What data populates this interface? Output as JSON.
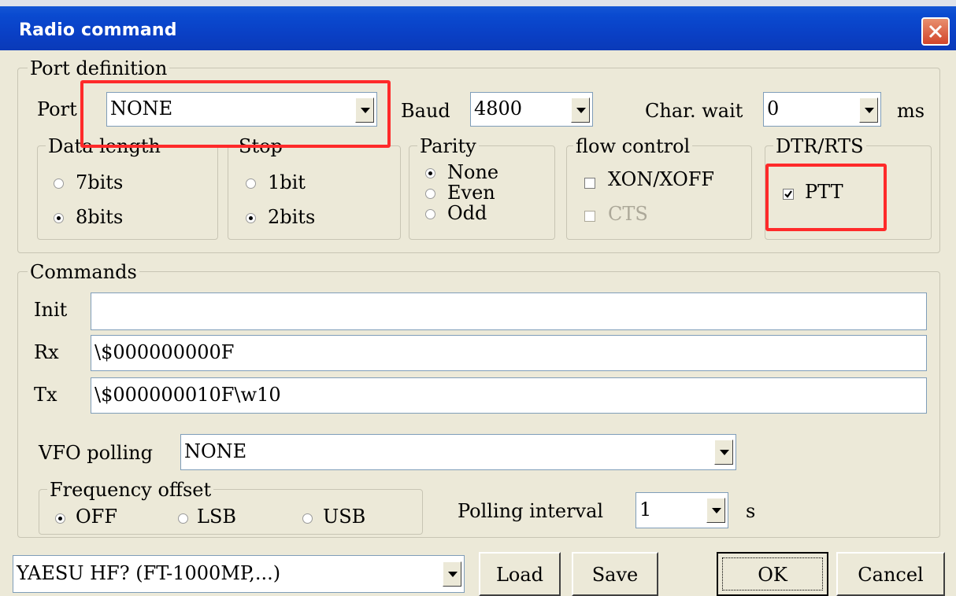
{
  "window": {
    "title": "Radio command"
  },
  "port_def": {
    "legend": "Port definition",
    "port_label": "Port",
    "port_value": "NONE",
    "baud_label": "Baud",
    "baud_value": "4800",
    "charwait_label": "Char. wait",
    "charwait_value": "0",
    "charwait_unit": "ms",
    "data_length": {
      "legend": "Data length",
      "options": [
        "7bits",
        "8bits"
      ],
      "selected": "8bits"
    },
    "stop": {
      "legend": "Stop",
      "options": [
        "1bit",
        "2bits"
      ],
      "selected": "2bits"
    },
    "parity": {
      "legend": "Parity",
      "options": [
        "None",
        "Even",
        "Odd"
      ],
      "selected": "None"
    },
    "flow": {
      "legend": "flow control",
      "xon_label": "XON/XOFF",
      "xon_checked": false,
      "cts_label": "CTS",
      "cts_checked": false,
      "cts_enabled": false
    },
    "dtr": {
      "legend": "DTR/RTS",
      "ptt_label": "PTT",
      "ptt_checked": true
    }
  },
  "commands": {
    "legend": "Commands",
    "init_label": "Init",
    "init_value": "",
    "rx_label": "Rx",
    "rx_value": "\\$000000000F",
    "tx_label": "Tx",
    "tx_value": "\\$000000010F\\w10",
    "vfo_label": "VFO polling",
    "vfo_value": "NONE",
    "freq": {
      "legend": "Frequency offset",
      "options": [
        "OFF",
        "LSB",
        "USB"
      ],
      "selected": "OFF"
    },
    "polling_label": "Polling interval",
    "polling_value": "1",
    "polling_unit": "s"
  },
  "bottom": {
    "preset_value": "YAESU HF? (FT-1000MP,...)",
    "load_label": "Load",
    "save_label": "Save",
    "ok_label": "OK",
    "cancel_label": "Cancel"
  },
  "colors": {
    "title_bar": "#0a3fc4",
    "highlight": "#ff2a2a",
    "face": "#ece9d8"
  }
}
